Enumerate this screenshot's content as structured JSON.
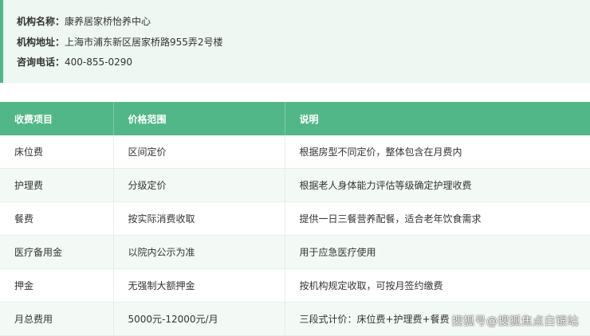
{
  "info": {
    "name_label": "机构名称：",
    "name_value": "康养居家桥怡养中心",
    "address_label": "机构地址：",
    "address_value": "上海市浦东新区居家桥路955弄2号楼",
    "phone_label": "咨询电话：",
    "phone_value": "400-855-0290"
  },
  "table": {
    "headers": [
      "收费项目",
      "价格范围",
      "说明"
    ],
    "rows": [
      [
        "床位费",
        "区间定价",
        "根据房型不同定价，整体包含在月费内"
      ],
      [
        "护理费",
        "分级定价",
        "根据老人身体能力评估等级确定护理收费"
      ],
      [
        "餐费",
        "按实际消费收取",
        "提供一日三餐营养配餐，适合老年饮食需求"
      ],
      [
        "医疗备用金",
        "以院内公示为准",
        "用于应急医疗使用"
      ],
      [
        "押金",
        "无强制大额押金",
        "按机构规定收取，可按月签约缴费"
      ],
      [
        "月总费用",
        "5000元-12000元/月",
        "三段式计价：床位费+护理费+餐费"
      ]
    ]
  },
  "watermark": "搜狐号@搜狐焦点白银站",
  "colors": {
    "accent": "#52b788",
    "info_bg": "#eef7f1",
    "stripe": "#f3faf6"
  }
}
